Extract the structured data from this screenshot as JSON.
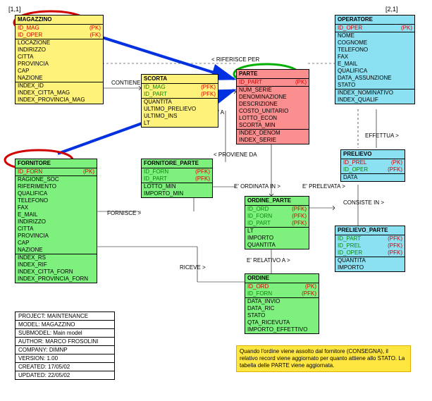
{
  "meta": {
    "pageRef1": "[1,1]",
    "pageRef2": "[2,1]"
  },
  "rel": {
    "riferisce": "< RIFERISCE PER",
    "contiene": "CONTIENE >",
    "ea": "E' A",
    "proviene": "< PROVIENE DA",
    "ordinata": "E' ORDINATA IN >",
    "prelevata": "E' PRELEVATA >",
    "consiste": "CONSISTE IN >",
    "effettua": "EFFETTUA >",
    "fornisce": "FORNISCE >",
    "riceve": "RICEVE >",
    "relativo": "E' RELATIVO A >"
  },
  "e": {
    "magazzino": {
      "name": "MAGAZZINO",
      "pk": [
        {
          "n": "ID_MAG",
          "t": "(PK)"
        },
        {
          "n": "ID_OPER",
          "t": "(FK)"
        }
      ],
      "a": [
        "LOCAZIONE",
        "INDIRIZZO",
        "CITTA",
        "PROVINCIA",
        "CAP",
        "NAZIONE"
      ],
      "idx": [
        "INDEX_ID",
        "INDEX_CITTA_MAG",
        "INDEX_PROVINCIA_MAG"
      ]
    },
    "scorta": {
      "name": "SCORTA",
      "pk": [
        {
          "n": "ID_MAG",
          "t": "(PFK)"
        },
        {
          "n": "ID_PART",
          "t": "(PFK)"
        }
      ],
      "a": [
        "QUANTITA",
        "ULTIMO_PRELIEVO",
        "ULTIMO_INS",
        "LT"
      ]
    },
    "parte": {
      "name": "PARTE",
      "pk": [
        {
          "n": "ID_PART",
          "t": "(PK)"
        }
      ],
      "a": [
        "NUM_SERIE",
        "DENOMINAZIONE",
        "DESCRIZIONE",
        "COSTO_UNITARIO",
        "LOTTO_ECON",
        "SCORTA_MIN"
      ],
      "idx": [
        "INDEX_DENOM",
        "INDEX_SERIE"
      ]
    },
    "operatore": {
      "name": "OPERATORE",
      "pk": [
        {
          "n": "ID_OPER",
          "t": "(PK)"
        }
      ],
      "a": [
        "NOME",
        "COGNOME",
        "TELEFONO",
        "FAX",
        "E_MAIL",
        "QUALIFICA",
        "DATA_ASSUNZIONE",
        "STATO"
      ],
      "idx": [
        "INDEX_NOMINATIVO",
        "INDEX_QUALIF"
      ]
    },
    "prelievo": {
      "name": "PRELIEVO",
      "pk": [
        {
          "n": "ID_PREL",
          "t": "(PK)"
        },
        {
          "n": "ID_OPER",
          "t": "(PFK)"
        }
      ],
      "a": [
        "DATA"
      ]
    },
    "prelievoParte": {
      "name": "PRELIEVO_PARTE",
      "pk": [
        {
          "n": "ID_PART",
          "t": "(PFK)"
        },
        {
          "n": "ID_PREL",
          "t": "(PFK)"
        },
        {
          "n": "ID_OPER",
          "t": "(PFK)"
        }
      ],
      "a": [
        "QUANTITA",
        "IMPORTO"
      ]
    },
    "fornitore": {
      "name": "FORNITORE",
      "pk": [
        {
          "n": "ID_FORN",
          "t": "(PK)"
        }
      ],
      "a": [
        "RAGIONE_SOC",
        "RIFERIMENTO",
        "QUALIFICA",
        "TELEFONO",
        "FAX",
        "E_MAIL",
        "INDIRIZZO",
        "CITTA",
        "PROVINCIA",
        "CAP",
        "NAZIONE"
      ],
      "idx": [
        "INDEX_RS",
        "INDEX_RIF",
        "INDEX_CITTA_FORN",
        "INDEX_PROVINCIA_FORN"
      ]
    },
    "fornitoreParte": {
      "name": "FORNITORE_PARTE",
      "pk": [
        {
          "n": "ID_FORN",
          "t": "(PFK)"
        },
        {
          "n": "ID_PART",
          "t": "(PFK)"
        }
      ],
      "a": [
        "LOTTO_MIN",
        "IMPORTO_MIN"
      ]
    },
    "ordineParte": {
      "name": "ORDINE_PARTE",
      "pk": [
        {
          "n": "ID_ORD",
          "t": "(PFK)"
        },
        {
          "n": "ID_FORN",
          "t": "(PFK)"
        },
        {
          "n": "ID_PART",
          "t": "(PFK)"
        }
      ],
      "a": [
        "LT",
        "IMPORTO",
        "QUANTITA"
      ]
    },
    "ordine": {
      "name": "ORDINE",
      "pk": [
        {
          "n": "ID_ORD",
          "t": "(PK)"
        },
        {
          "n": "ID_FORN",
          "t": "(PFK)"
        }
      ],
      "a": [
        "DATA_INVIO",
        "DATA_RIC",
        "STATO",
        "QTA_RICEVUTA",
        "IMPORTO_EFFETTIVO"
      ]
    }
  },
  "info": {
    "project": "PROJECT: MAINTENANCE",
    "model": "MODEL: MAGAZZINO",
    "submodel": "SUBMODEL: Main model",
    "author": "AUTHOR: MARCO FROSOLINI",
    "company": "COMPANY: DIMNP",
    "version": "VERSION: 1.00",
    "created": "CREATED: 17/05/02",
    "updated": "UPDATED: 22/05/02"
  },
  "note": {
    "text": "Quando l'ordine viene assolto dal fornitore (CONSEGNA), il relativo record viene aggiornato per quanto attiene allo STATO. La tabella delle PARTE viene aggiornata."
  }
}
